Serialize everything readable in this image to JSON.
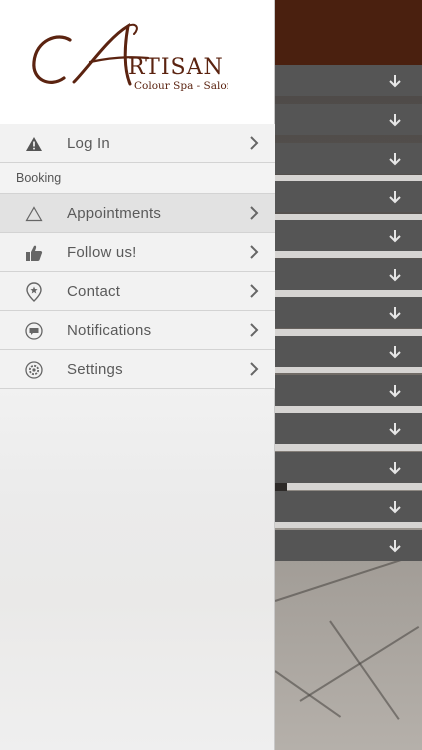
{
  "brand": {
    "name_initial": "A",
    "name_rest": "RTISAN",
    "tagline": "Colour Spa - Salon",
    "color": "#5b2310"
  },
  "menu": {
    "login": {
      "label": "Log In",
      "icon": "warning-icon"
    },
    "section_booking": "Booking",
    "items": [
      {
        "label": "Appointments",
        "icon": "triangle-icon",
        "active": true
      },
      {
        "label": "Follow us!",
        "icon": "thumbs-up-icon"
      },
      {
        "label": "Contact",
        "icon": "location-pin-icon"
      },
      {
        "label": "Notifications",
        "icon": "chat-bubble-icon"
      },
      {
        "label": "Settings",
        "icon": "gear-icon"
      }
    ]
  },
  "background": {
    "header_color": "#4a200f",
    "row_color": "#555555",
    "row_icon": "download-arrow-icon"
  }
}
